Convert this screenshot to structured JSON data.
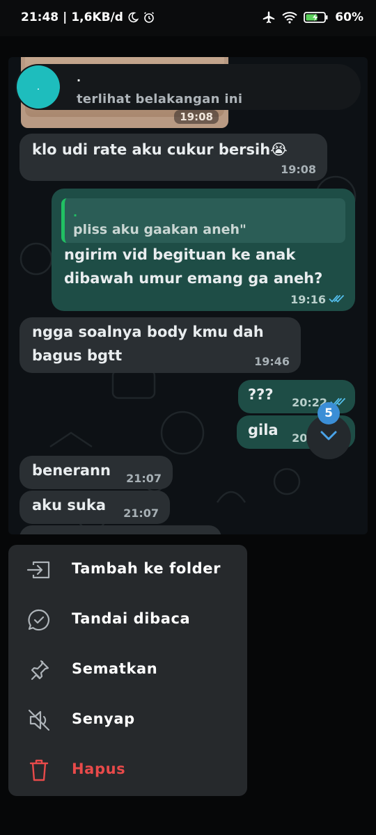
{
  "status_bar": {
    "time": "21:48",
    "separator": "|",
    "network_speed": "1,6KB/d",
    "battery": "60%"
  },
  "chat": {
    "popup": {
      "avatar_label": ".",
      "title": ".",
      "subtitle": "terlihat belakangan ini"
    },
    "image_time": "19:08",
    "messages": [
      {
        "text": "klo udi rate aku cukur bersih😭",
        "time": "19:08",
        "dir": "in"
      },
      {
        "quote_author": ".",
        "quote_text": "pliss aku gaakan aneh\"",
        "line1": "ngirim vid begituan ke anak",
        "line2": "dibawah umur emang ga aneh?",
        "time": "19:16",
        "dir": "out"
      },
      {
        "line1": "ngga soalnya body kmu dah",
        "line2": "bagus bgtt",
        "time": "19:46",
        "dir": "in"
      },
      {
        "text": "???",
        "time": "20:22",
        "dir": "out"
      },
      {
        "text": "gila",
        "time": "20:22",
        "dir": "out"
      },
      {
        "text": "benerann",
        "time": "21:07",
        "dir": "in"
      },
      {
        "text": "aku suka",
        "time": "21:07",
        "dir": "in"
      }
    ],
    "unread_count": "5"
  },
  "menu": {
    "items": [
      {
        "label": "Tambah ke folder",
        "icon": "folder-move-icon"
      },
      {
        "label": "Tandai dibaca",
        "icon": "chat-check-icon"
      },
      {
        "label": "Sematkan",
        "icon": "pin-icon"
      },
      {
        "label": "Senyap",
        "icon": "mute-icon"
      },
      {
        "label": "Hapus",
        "icon": "trash-icon"
      }
    ]
  },
  "colors": {
    "incoming_bubble": "#2a2f33",
    "outgoing_bubble": "#1e4d46",
    "read_ticks": "#53bdeb",
    "danger": "#e84a4a",
    "avatar": "#1ebdbd",
    "badge": "#3b8ed6"
  }
}
